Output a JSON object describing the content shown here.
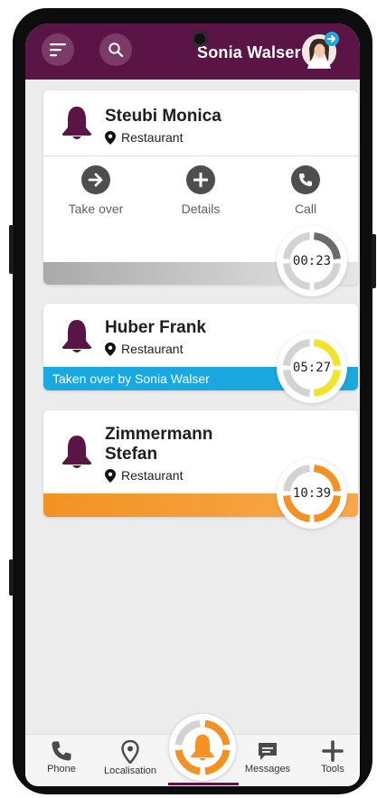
{
  "header": {
    "user_name": "Sonia Walser",
    "menu_icon": "menu-icon",
    "search_icon": "search-icon",
    "bg_color": "#5a1546"
  },
  "alarms": [
    {
      "name": "Steubi Monica",
      "location": "Restaurant",
      "actions": [
        {
          "label": "Take over",
          "icon": "arrow-right-icon"
        },
        {
          "label": "Details",
          "icon": "plus-icon"
        },
        {
          "label": "Call",
          "icon": "phone-icon"
        }
      ],
      "timer": "00:23",
      "status_color": "#8a8a8a"
    },
    {
      "name": "Huber Frank",
      "location": "Restaurant",
      "status_text": "Taken over by Sonia Walser",
      "timer": "05:27",
      "status_color": "#1aa8e0",
      "timer_color": "#f2e42a"
    },
    {
      "name_line1": "Zimmermann",
      "name_line2": "Stefan",
      "location": "Restaurant",
      "timer": "10:39",
      "status_color": "#f39223"
    }
  ],
  "nav": {
    "items": [
      {
        "label": "Phone",
        "icon": "phone-icon"
      },
      {
        "label": "Localisation",
        "icon": "location-pin-icon"
      },
      {
        "label": "Messages",
        "icon": "message-icon"
      },
      {
        "label": "Tools",
        "icon": "plus-icon"
      }
    ],
    "center_icon": "bell-icon"
  }
}
